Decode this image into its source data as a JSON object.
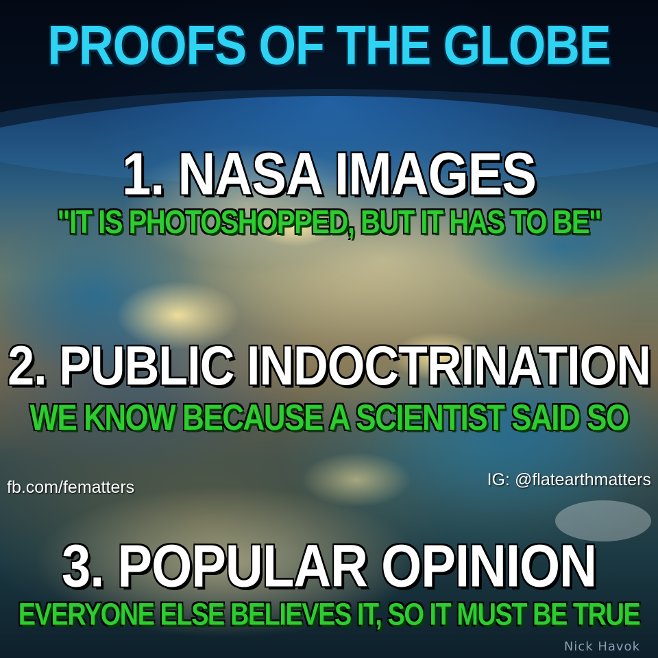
{
  "heading": "PROOFS OF THE GLOBE",
  "points": [
    {
      "title": "1. NASA IMAGES",
      "subtitle": "\"IT IS PHOTOSHOPPED, BUT IT HAS TO BE\""
    },
    {
      "title": "2. PUBLIC INDOCTRINATION",
      "subtitle": "WE KNOW BECAUSE A SCIENTIST SAID SO"
    },
    {
      "title": "3. POPULAR OPINION",
      "subtitle": "EVERYONE ELSE BELIEVES IT, SO IT MUST BE TRUE"
    }
  ],
  "credits": {
    "facebook": "fb.com/fematters",
    "instagram": "IG: @flatearthmatters",
    "signature": "Nick Havok"
  },
  "colors": {
    "heading": "#2ed2f2",
    "title": "#ffffff",
    "subtitle": "#2ecc30"
  }
}
